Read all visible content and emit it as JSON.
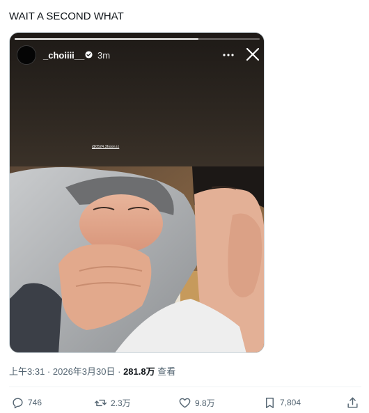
{
  "tweet": {
    "text": "WAIT A SECOND WHAT"
  },
  "story": {
    "username": "_choiiii__",
    "time": "3m",
    "progress": 0.75,
    "mention": "@0524.3hoon.iz",
    "icons": {
      "verified": "verified-badge-icon",
      "more": "more-dots-icon",
      "close": "close-x-icon"
    }
  },
  "meta": {
    "time": "上午3:31",
    "sep1": " · ",
    "date": "2026年3月30日",
    "sep2": " · ",
    "views": "281.8万",
    "views_label": " 查看"
  },
  "actions": {
    "replies": "746",
    "retweets": "2.3万",
    "likes": "9.8万",
    "bookmarks": "7,804",
    "icons": [
      "reply-icon",
      "retweet-icon",
      "like-heart-icon",
      "bookmark-icon",
      "share-icon"
    ]
  },
  "colors": {
    "text_primary": "#0f1419",
    "text_secondary": "#536471",
    "divider": "#eff3f4",
    "card_border": "#cfd9de"
  }
}
